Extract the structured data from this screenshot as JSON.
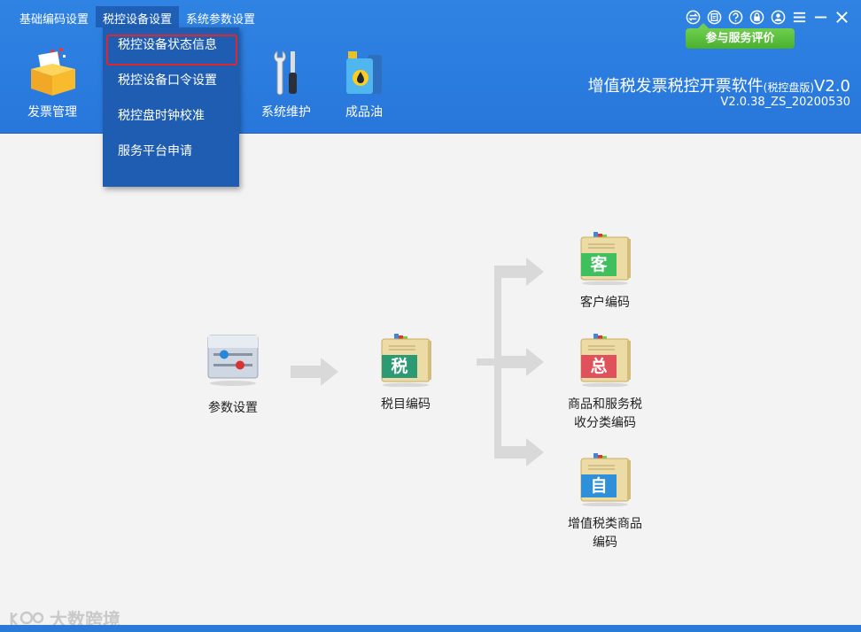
{
  "menubar": {
    "items": [
      {
        "label": "基础编码设置"
      },
      {
        "label": "税控设备设置"
      },
      {
        "label": "系统参数设置"
      }
    ]
  },
  "dropdown": {
    "items": [
      {
        "label": "税控设备状态信息"
      },
      {
        "label": "税控设备口令设置"
      },
      {
        "label": "税控盘时钟校准"
      },
      {
        "label": "服务平台申请"
      }
    ]
  },
  "toolbar": {
    "invoice": "发票管理",
    "maintenance": "系统维护",
    "oil": "成品油"
  },
  "feedback": "参与服务评价",
  "app": {
    "title": "增值税发票税控开票软件",
    "title_suffix": "(税控盘版)",
    "title_ver": "V2.0",
    "version": "V2.0.38_ZS_20200530"
  },
  "diagram": {
    "params": "参数设置",
    "tax_item": "税目编码",
    "tax_char": "税",
    "customer": "客户编码",
    "customer_char": "客",
    "goods_line1": "商品和服务税",
    "goods_line2": "收分类编码",
    "goods_char": "总",
    "vat_line1": "增值税类商品",
    "vat_line2": "编码",
    "vat_char": "自"
  },
  "watermark": "大数跨境",
  "colors": {
    "header": "#2f83e2",
    "dropdown": "#1e5db1",
    "highlight": "#e0262d",
    "feedback": "#49b02e"
  }
}
